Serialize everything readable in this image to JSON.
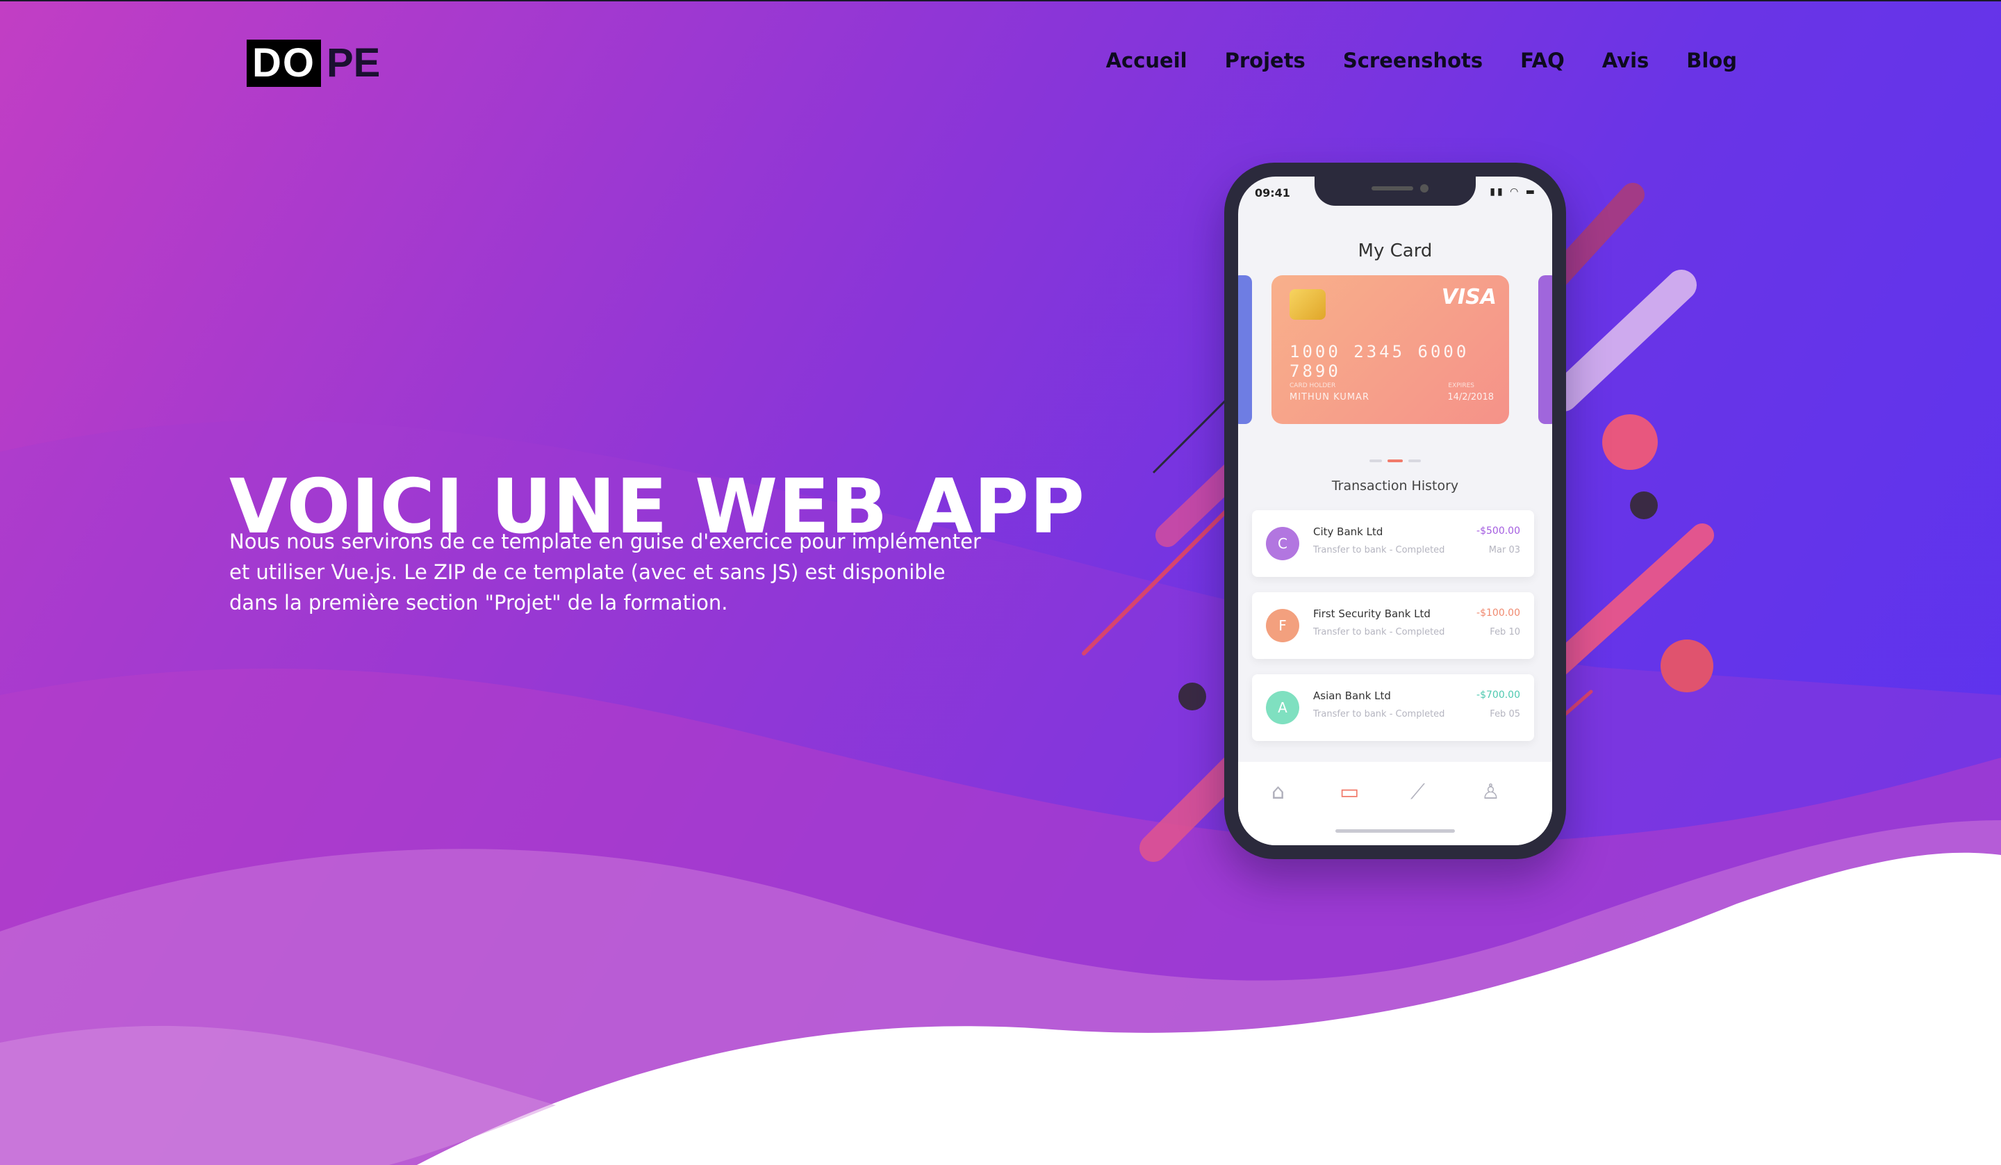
{
  "brand": {
    "logo_box": "DO",
    "logo_rest": "PE"
  },
  "nav": {
    "items": [
      "Accueil",
      "Projets",
      "Screenshots",
      "FAQ",
      "Avis",
      "Blog"
    ]
  },
  "hero": {
    "title": "VOICI UNE WEB APP",
    "text": "Nous nous servirons de ce template en guise d'exercice pour implémenter et utiliser Vue.js. Le ZIP de ce template (avec et sans JS) est disponible dans la première section \"Projet\" de la formation."
  },
  "phone": {
    "time": "09:41",
    "screen_title": "My Card",
    "card": {
      "brand": "VISA",
      "number": "1000 2345 6000 7890",
      "holder_label": "CARD HOLDER",
      "holder": "MITHUN KUMAR",
      "expiry_label": "EXPIRES",
      "expiry": "14/2/2018"
    },
    "section_title": "Transaction History",
    "transactions": [
      {
        "initial": "C",
        "name": "City Bank Ltd",
        "sub": "Transfer to bank - Completed",
        "amount": "-$500.00",
        "date": "Mar 03",
        "color": "#b276e0",
        "amount_color": "#a45de0"
      },
      {
        "initial": "F",
        "name": "First Security Bank Ltd",
        "sub": "Transfer to bank - Completed",
        "amount": "-$100.00",
        "date": "Feb 10",
        "color": "#f3a07e",
        "amount_color": "#f08a70"
      },
      {
        "initial": "A",
        "name": "Asian Bank Ltd",
        "sub": "Transfer to bank - Completed",
        "amount": "-$700.00",
        "date": "Feb 05",
        "color": "#7fe0c0",
        "amount_color": "#4fc9b0"
      }
    ],
    "tabs": [
      "home-icon",
      "card-icon",
      "chart-icon",
      "user-icon"
    ]
  },
  "colors": {
    "gradient_start": "#c23ec4",
    "gradient_end": "#5a33f0",
    "accent": "#f17a6a"
  }
}
